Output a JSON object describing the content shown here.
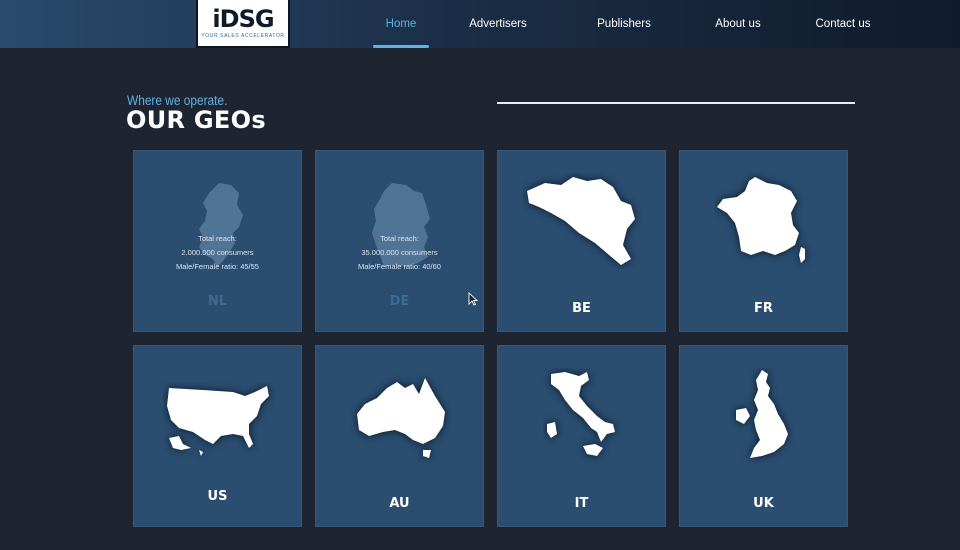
{
  "header": {
    "logo": {
      "mark": "iDSG",
      "tagline": "YOUR SALES ACCELERATOR"
    },
    "nav": [
      {
        "label": "Home",
        "active": true
      },
      {
        "label": "Advertisers"
      },
      {
        "label": "Publishers"
      },
      {
        "label": "About us"
      },
      {
        "label": "Contact us"
      }
    ]
  },
  "section": {
    "subtitle": "Where we operate.",
    "title": "OUR GEOs"
  },
  "geos": [
    {
      "code": "NL",
      "hovered": true,
      "info": {
        "line1": "Total reach:",
        "line2": "2.000.000 consumers",
        "line3": "Male/Female ratio: 45/55"
      }
    },
    {
      "code": "DE",
      "hovered": true,
      "info": {
        "line1": "Total reach:",
        "line2": "35.000.000 consumers",
        "line3": "Male/Female ratio: 40/60"
      }
    },
    {
      "code": "BE"
    },
    {
      "code": "FR"
    },
    {
      "code": "US"
    },
    {
      "code": "AU"
    },
    {
      "code": "IT"
    },
    {
      "code": "UK"
    }
  ],
  "colors": {
    "background": "#1e2530",
    "card": "#2a4d70",
    "accent": "#5ab4e6"
  }
}
